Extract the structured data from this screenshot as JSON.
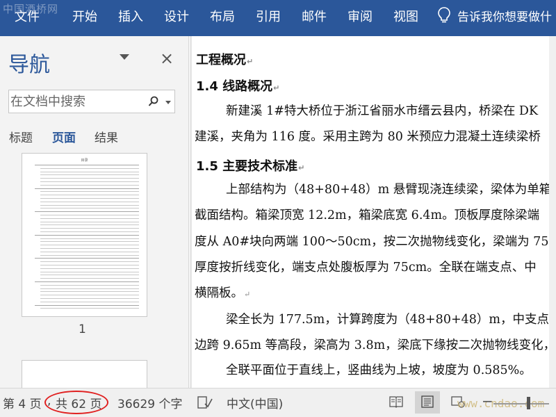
{
  "ribbon": {
    "watermark": "中国酒桥网",
    "tabs": [
      "文件",
      "开始",
      "插入",
      "设计",
      "布局",
      "引用",
      "邮件",
      "审阅",
      "视图"
    ],
    "tell_me": "告诉我你想要做什"
  },
  "nav": {
    "title": "导航",
    "close": "×",
    "search_placeholder": "在文档中搜索",
    "tabs": [
      "标题",
      "页面",
      "结果"
    ],
    "active_tab": "页面",
    "thumbnail_title": "目录",
    "thumbnail_page": "1"
  },
  "document": {
    "lines": [
      "工程概况",
      "1.4 线路概况",
      "新建溪 1#特大桥位于浙江省丽水市缙云县内，桥梁在 DK",
      "建溪，夹角为 116 度。采用主跨为 80 米预应力混凝土连续梁桥",
      "1.5 主要技术标准",
      "上部结构为（48+80+48）m 悬臂现浇连续梁，梁体为单箱",
      "截面结构。箱梁顶宽 12.2m，箱梁底宽 6.4m。顶板厚度除梁端",
      "度从 A0#块向两端 100～50cm，按二次抛物线变化，梁端为 75cm",
      "厚度按折线变化，端支点处腹板厚为 75cm。全联在端支点、中",
      "横隔板。",
      "梁全长为 177.5m，计算跨度为（48+80+48）m，中支点处",
      "边跨 9.65m 等高段，梁高为 3.8m，梁底下缘按二次抛物线变化，",
      "全联平面位于直线上，竖曲线为上坡，坡度为 0.585%。"
    ],
    "para_mark": "↵"
  },
  "status": {
    "page": "第 4 页",
    "separator": ",",
    "total_pages": "共 62 页",
    "word_count": "36629 个字",
    "language": "中文(中国)",
    "watermark": "www.cndao.com"
  },
  "colors": {
    "ribbon": "#2b579a",
    "nav_bg": "#f3f3f3",
    "accent": "#2b579a",
    "highlight_circle": "#e02020"
  }
}
